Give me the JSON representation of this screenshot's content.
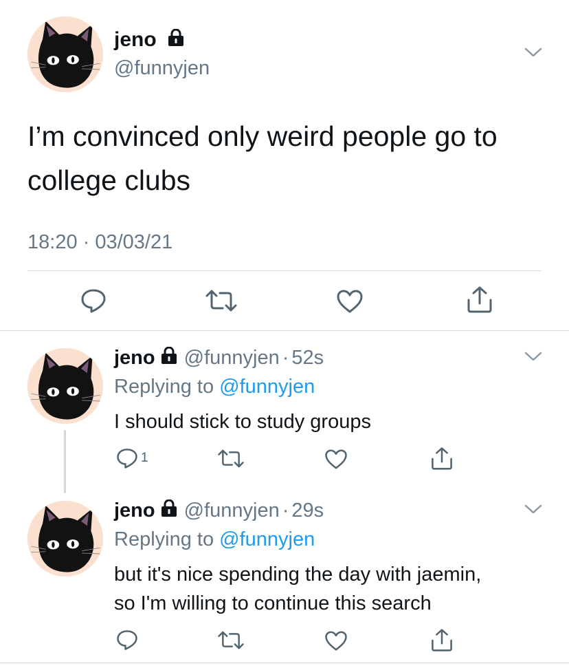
{
  "main_tweet": {
    "display_name": "jeno",
    "handle": "@funnyjen",
    "text_line1": "I’m convinced only weird people go to",
    "text_line2": "college clubs",
    "timestamp": "18:20 · 03/03/21"
  },
  "replies": [
    {
      "display_name": "jeno",
      "handle": "@funnyjen",
      "separator": "·",
      "time": "52s",
      "replying_prefix": "Replying to",
      "replying_to": "@funnyjen",
      "text_line1": "I should stick to study groups",
      "text_line2": "",
      "reply_count": "1"
    },
    {
      "display_name": "jeno",
      "handle": "@funnyjen",
      "separator": "·",
      "time": "29s",
      "replying_prefix": "Replying to",
      "replying_to": "@funnyjen",
      "text_line1": "but it's nice spending the day with jaemin,",
      "text_line2": "so I'm willing to continue this search",
      "reply_count": ""
    }
  ],
  "icons": {
    "avatar": "black-cat-avatar",
    "lock": "lock-icon",
    "menu": "chevron-down-icon",
    "reply": "reply-icon",
    "retweet": "retweet-icon",
    "like": "heart-icon",
    "share": "share-icon"
  },
  "colors": {
    "text": "#0f1419",
    "secondary": "#657786",
    "link": "#1d9bf0",
    "avatar_bg": "#fbe0cf"
  }
}
